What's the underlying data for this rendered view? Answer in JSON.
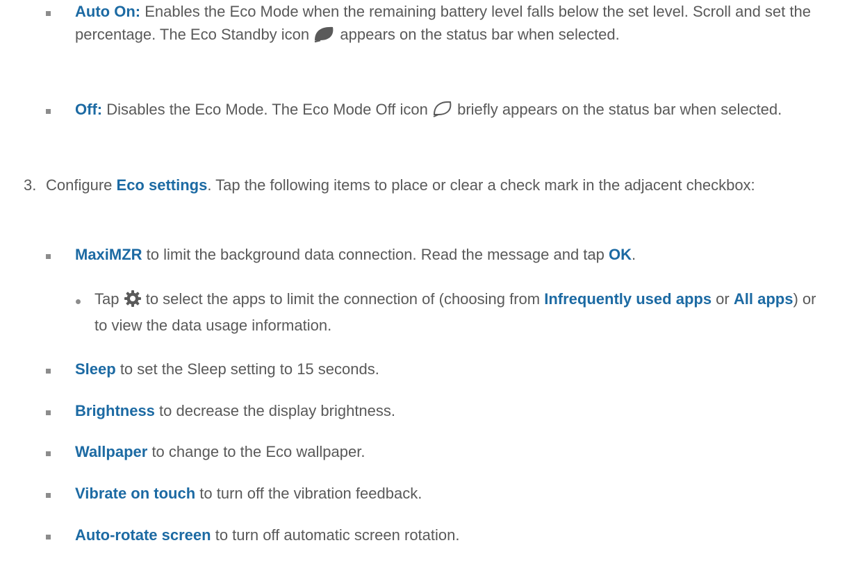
{
  "colors": {
    "text": "#595959",
    "accent": "#1c6aa3",
    "bullet": "#8c8c8c"
  },
  "auto_on": {
    "label": "Auto On:",
    "text_a": " Enables the Eco Mode when the remaining battery level falls below the set level. Scroll and set the percentage. The Eco Standby icon ",
    "icon": "eco-standby-leaf-icon",
    "text_b": " appears on the status bar when selected."
  },
  "off": {
    "label": "Off:",
    "text_a": " Disables the Eco Mode. The Eco Mode Off icon ",
    "icon": "eco-mode-off-leaf-icon",
    "text_b": " briefly appears on the status bar when selected."
  },
  "step3": {
    "number": "3.",
    "text_a": "Configure ",
    "bold": "Eco settings",
    "text_b": ". Tap the following items to place or clear a check mark in the adjacent checkbox:"
  },
  "maximzr": {
    "label": "MaxiMZR",
    "text_a": " to limit the background data connection. Read the message and tap ",
    "ok": "OK",
    "text_b": "."
  },
  "maximzr_sub": {
    "text_a": "Tap ",
    "icon": "gear-icon",
    "text_b": " to select the apps to limit the connection of (choosing from ",
    "bold1": "Infrequently used apps",
    "text_c": " or ",
    "bold2": "All apps",
    "text_d": ") or to view the data usage information."
  },
  "items": [
    {
      "label": "Sleep",
      "text": " to set the Sleep setting to 15 seconds."
    },
    {
      "label": "Brightness",
      "text": " to decrease the display brightness."
    },
    {
      "label": "Wallpaper",
      "text": " to change to the Eco wallpaper."
    },
    {
      "label": "Vibrate on touch",
      "text": " to turn off the vibration feedback."
    },
    {
      "label": "Auto-rotate screen",
      "text": " to turn off automatic screen rotation."
    }
  ]
}
